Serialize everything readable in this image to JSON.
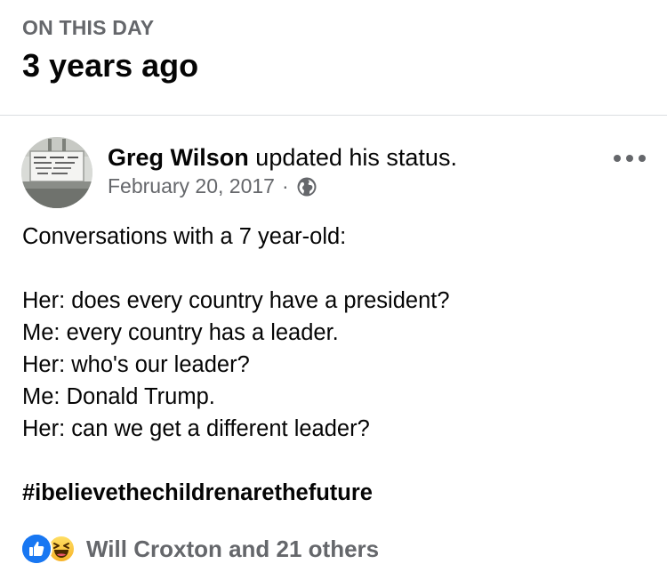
{
  "memory": {
    "label": "ON THIS DAY",
    "headline": "3 years ago"
  },
  "post": {
    "author": "Greg Wilson",
    "action": "updated his status.",
    "date": "February 20, 2017",
    "separator": "·",
    "privacy_icon": "globe-icon",
    "more_icon": "more-options-icon",
    "body_lines": [
      "Conversations with a 7 year-old:",
      "",
      "Her: does every country have a president?",
      "Me: every country has a leader.",
      "Her: who's our leader?",
      "Me: Donald Trump.",
      "Her: can we get a different leader?",
      ""
    ],
    "hashtag": "#ibelievethechildrenarethefuture"
  },
  "reactions": {
    "icons": [
      "like-icon",
      "haha-icon"
    ],
    "summary": "Will Croxton and 21 others"
  },
  "colors": {
    "secondary_text": "#65676b",
    "primary_text": "#050505",
    "like_blue": "#1877f2",
    "divider": "#dadde1"
  }
}
